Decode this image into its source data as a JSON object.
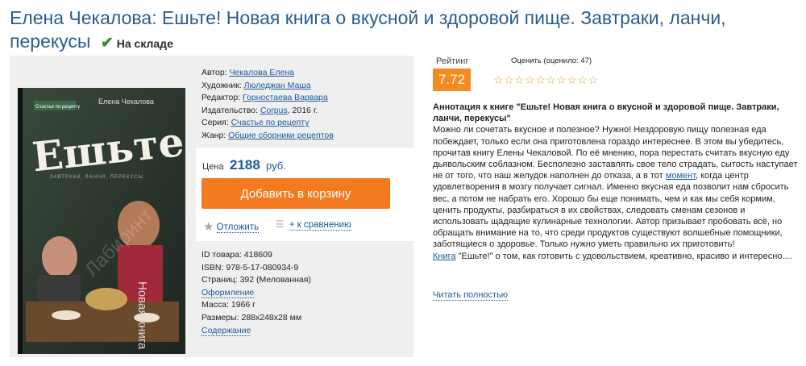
{
  "title": "Елена Чекалова: Ешьте! Новая книга о вкусной и здоровой пище. Завтраки, ланчи, перекусы",
  "stock": "На складе",
  "cover": {
    "series_badge": "Счастье по рецепту",
    "author_small": "Елена Чекалова",
    "title_big": "Ешьте!",
    "subtitle": "Новая книга о вкусной и здоровой пище"
  },
  "meta": {
    "author_label": "Автор:",
    "author": "Чекалова Елена",
    "artist_label": "Художник:",
    "artist": "Люледжан Маша",
    "editor_label": "Редактор:",
    "editor": "Горностаева Варвара",
    "publisher_label": "Издательство:",
    "publisher": "Corpus",
    "year": ", 2016 г.",
    "series_label": "Серия:",
    "series": "Счастье по рецепту",
    "genre_label": "Жанр:",
    "genre": "Общие сборники рецептов"
  },
  "price": {
    "label": "Цена",
    "value": "2188",
    "currency": "руб."
  },
  "cart_button": "Добавить в корзину",
  "actions": {
    "defer": "Отложить",
    "compare": "+ к сравнению"
  },
  "info": {
    "id_label": "ID товара:",
    "id": "418609",
    "isbn_label": "ISBN:",
    "isbn": "978-5-17-080934-9",
    "pages_label": "Страниц:",
    "pages": "392 (Мелованная)",
    "design": "Оформление",
    "weight_label": "Масса:",
    "weight": "1966 г",
    "size_label": "Размеры:",
    "size": "288x248x28 мм",
    "contents": "Содержание"
  },
  "rating": {
    "label": "Рейтинг",
    "value": "7.72",
    "rate_label": "Оценить (оценило: 47)",
    "stars": "☆☆☆☆☆☆☆☆☆☆",
    "star_color": "#d9a83a"
  },
  "annotation": {
    "title": "Аннотация к книге \"Ешьте! Новая книга о вкусной и здоровой пище. Завтраки, ланчи, перекусы\"",
    "body_1": "Можно ли сочетать вкусное и полезное? Нужно! Нездоровую пищу полезная еда побеждает, только если она приготовлена гораздо интереснее. В этом вы убедитесь, прочитав книгу Елены Чекаловой. По её мнению, пора перестать считать вкусную еду дьявольским соблазном. Бесполезно заставлять свое тело страдать, сытость наступает не от того, что наш желудок наполнен до отказа, а в тот ",
    "link_moment": "момент",
    "body_2": ", когда центр удовлетворения в мозгу получает сигнал. Именно вкусная еда позволит нам сбросить вес, а потом не набрать его. Хорошо бы еще понимать, чем и как мы себя кормим, ценить продукты, разбираться в их свойствах, следовать сменам сезонов и использовать щадящие кулинарные технологии. Автор призывает пробовать всё, но обращать внимание на то, что среди продуктов существуют волшебные помощники, заботящиеся о здоровье. Только нужно уметь правильно их приготовить!",
    "link_book": "Книга",
    "body_3": " \"Ешьте!\" о том, как готовить с удовольствием, креативно, красиво и интересно....",
    "read_more": "Читать полностью"
  },
  "colors": {
    "accent": "#f47a1f",
    "title": "#2a5d8f",
    "link": "#1a5a9c",
    "stock_check": "#3f8b27"
  }
}
